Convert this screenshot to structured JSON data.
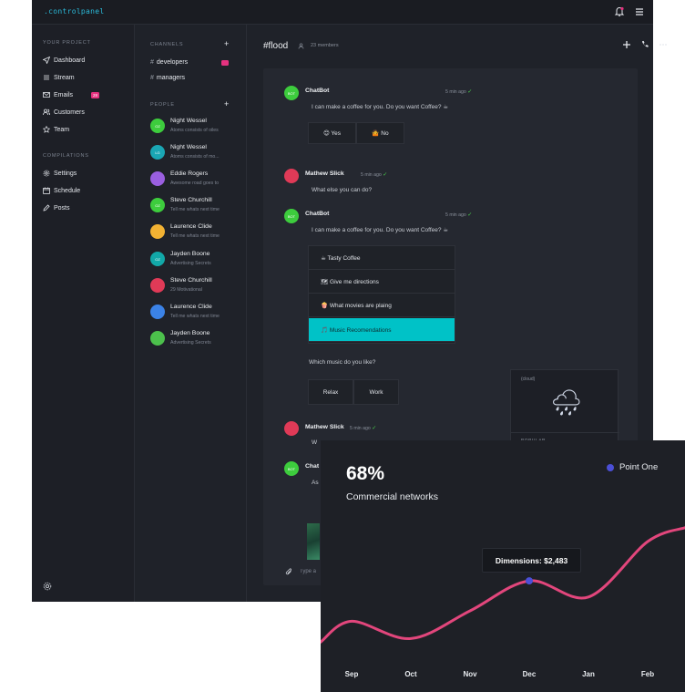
{
  "app": {
    "brand": ".controlpanel",
    "nav": {
      "heading_project": "YOUR PROJECT",
      "items": [
        {
          "label": "Dashboard",
          "icon": "send-icon"
        },
        {
          "label": "Stream",
          "icon": "stream-icon"
        },
        {
          "label": "Emails",
          "icon": "mail-icon",
          "badge": "28"
        },
        {
          "label": "Customers",
          "icon": "users-icon"
        },
        {
          "label": "Team",
          "icon": "star-icon"
        }
      ],
      "heading_compilations": "COMPILATIONS",
      "items2": [
        {
          "label": "Settings",
          "icon": "gear-icon"
        },
        {
          "label": "Schedule",
          "icon": "calendar-icon"
        },
        {
          "label": "Posts",
          "icon": "pencil-icon"
        }
      ]
    },
    "channels": {
      "heading": "CHANNELS",
      "list": [
        {
          "hash": "#",
          "name": "developers",
          "badge": "12"
        },
        {
          "hash": "#",
          "name": "managers"
        }
      ],
      "people_heading": "PEOPLE",
      "people": [
        {
          "initials": "OZ",
          "name": "Night Wessel",
          "sub": "Atoms consists of oiles",
          "color": "#3dcc3d"
        },
        {
          "initials": "LG",
          "name": "Night Wessel",
          "sub": "Atoms consists of mo...",
          "color": "#1aa6b4"
        },
        {
          "initials": "",
          "name": "Eddie Rogers",
          "sub": "Awesome road goes to",
          "color": "#9a5fe0"
        },
        {
          "initials": "OZ",
          "name": "Steve Churchill",
          "sub": "Tell me whats next time",
          "color": "#3dcc3d"
        },
        {
          "initials": "",
          "name": "Laurence Clide",
          "sub": "Tell me whats next time",
          "color": "#f2b233"
        },
        {
          "initials": "OZ",
          "name": "Jayden Boone",
          "sub": "Advertising Secrets",
          "color": "#12a8a8"
        },
        {
          "initials": "",
          "name": "Steve Churchill",
          "sub": "29 Motivational",
          "color": "#e03a57"
        },
        {
          "initials": "",
          "name": "Laurence Clide",
          "sub": "Tell me whats next time",
          "color": "#3b82e6"
        },
        {
          "initials": "",
          "name": "Jayden Boone",
          "sub": "Advertising Secrets",
          "color": "#4cc04c"
        }
      ]
    },
    "chat": {
      "title": "#flood",
      "members": "23 members",
      "messages": [
        {
          "avatar": "BOT",
          "author": "ChatBot",
          "time": "5 min ago",
          "text": "I can make a coffee for you. Do you want Coffee? ☕",
          "buttons": [
            "😊 Yes",
            "🤷 No"
          ]
        },
        {
          "avatar": "",
          "author": "Mathew Slick",
          "time": "5 min ago",
          "text": "What else you can do?"
        },
        {
          "avatar": "BOT",
          "author": "ChatBot",
          "time": "5 min ago",
          "text": "I can make a coffee for you. Do you want Coffee? ☕",
          "options": [
            "☕ Tasty Coffee",
            "🗺 Give me directions",
            "🍿 What movies are plaing",
            "🎵 Music Recomendations"
          ]
        },
        {
          "text": "Which music do you like?",
          "buttons": [
            "Relax",
            "Work"
          ]
        },
        {
          "avatar": "",
          "author": "Mathew Slick",
          "time": "5 min ago",
          "text": "W"
        },
        {
          "avatar": "BOT",
          "author": "Chat",
          "text": "As"
        }
      ],
      "weather_tag": "(cloud)",
      "weather_emoji": "🌧",
      "weather_footer": "POPULAR",
      "input_placeholder": "Type a"
    }
  },
  "card": {
    "kpi_value": "68%",
    "kpi_label": "Commercial networks",
    "legend": "Point One",
    "tooltip": "Dimensions: $2,483",
    "colors": {
      "line": "#e2467c",
      "point": "#4b4fd6",
      "card": "#1e2026"
    }
  },
  "chart_data": {
    "type": "line",
    "categories": [
      "Sep",
      "Oct",
      "Nov",
      "Dec",
      "Jan",
      "Feb"
    ],
    "series": [
      {
        "name": "Point One",
        "values": [
          1900,
          1650,
          2050,
          2483,
          2250,
          3050
        ]
      }
    ],
    "highlight": {
      "category": "Dec",
      "label": "Dimensions: $2,483"
    },
    "grid": false,
    "legend": "top-right"
  }
}
